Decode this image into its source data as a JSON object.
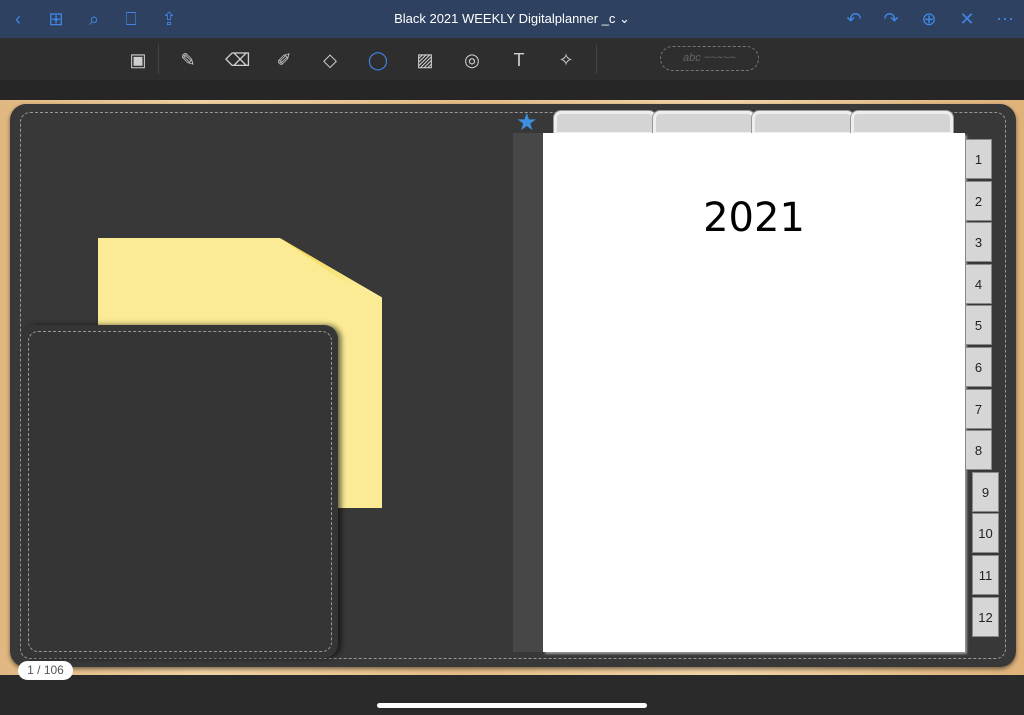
{
  "header": {
    "title": "Black 2021 WEEKLY Digitalplanner _c ⌄",
    "left_icons": [
      "back-icon",
      "grid-icon",
      "search-icon",
      "bookmark-icon",
      "share-icon"
    ],
    "right_icons": [
      "undo-icon",
      "redo-icon",
      "add-page-icon",
      "close-icon",
      "more-icon"
    ]
  },
  "toolbar": {
    "tools": [
      "read-mode-icon",
      "pen-icon",
      "eraser-icon",
      "highlighter-icon",
      "shapes-icon",
      "lasso-icon",
      "image-icon",
      "camera-icon",
      "text-icon",
      "laser-pointer-icon"
    ],
    "handwriting_placeholder": "abc ~~~~~"
  },
  "page": {
    "year": "2021"
  },
  "month_tabs": [
    "1",
    "2",
    "3",
    "4",
    "5",
    "6",
    "7",
    "8",
    "9",
    "10",
    "11",
    "12"
  ],
  "page_counter": "1 / 106",
  "colors": {
    "accent": "#3f86e6",
    "header": "#2f4160",
    "sticky": "#fbeb95"
  }
}
